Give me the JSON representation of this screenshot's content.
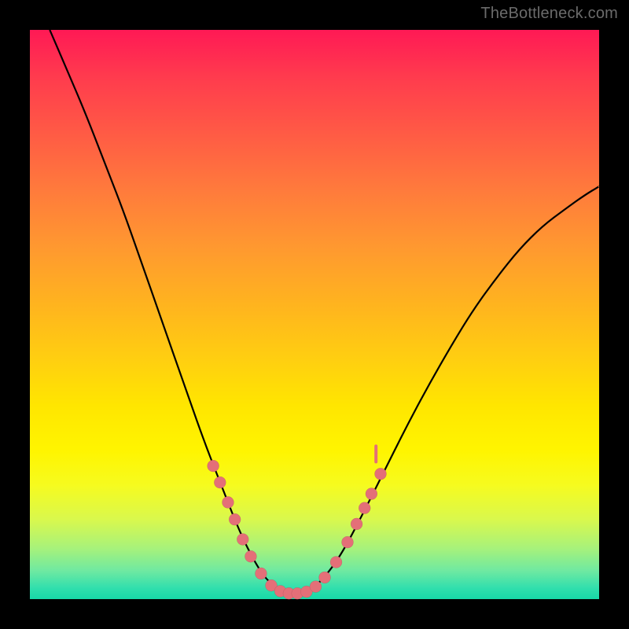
{
  "watermark": "TheBottleneck.com",
  "chart_data": {
    "type": "line",
    "title": "",
    "xlabel": "",
    "ylabel": "",
    "xlim": [
      0,
      1
    ],
    "ylim": [
      0,
      1
    ],
    "series": [
      {
        "name": "bottleneck-curve",
        "points": [
          [
            0.035,
            1.0
          ],
          [
            0.065,
            0.93
          ],
          [
            0.095,
            0.86
          ],
          [
            0.13,
            0.77
          ],
          [
            0.165,
            0.68
          ],
          [
            0.2,
            0.58
          ],
          [
            0.235,
            0.48
          ],
          [
            0.27,
            0.38
          ],
          [
            0.305,
            0.28
          ],
          [
            0.34,
            0.19
          ],
          [
            0.37,
            0.115
          ],
          [
            0.395,
            0.065
          ],
          [
            0.415,
            0.035
          ],
          [
            0.435,
            0.018
          ],
          [
            0.455,
            0.01
          ],
          [
            0.475,
            0.01
          ],
          [
            0.495,
            0.018
          ],
          [
            0.515,
            0.035
          ],
          [
            0.545,
            0.075
          ],
          [
            0.58,
            0.14
          ],
          [
            0.62,
            0.22
          ],
          [
            0.66,
            0.3
          ],
          [
            0.7,
            0.375
          ],
          [
            0.74,
            0.445
          ],
          [
            0.78,
            0.51
          ],
          [
            0.82,
            0.565
          ],
          [
            0.86,
            0.615
          ],
          [
            0.9,
            0.655
          ],
          [
            0.94,
            0.685
          ],
          [
            0.975,
            0.71
          ],
          [
            1.0,
            0.725
          ]
        ]
      }
    ],
    "markers": [
      {
        "xy": [
          0.322,
          0.234
        ],
        "kind": "dot"
      },
      {
        "xy": [
          0.334,
          0.205
        ],
        "kind": "dot"
      },
      {
        "xy": [
          0.348,
          0.17
        ],
        "kind": "dot"
      },
      {
        "xy": [
          0.36,
          0.14
        ],
        "kind": "dot"
      },
      {
        "xy": [
          0.374,
          0.105
        ],
        "kind": "dot"
      },
      {
        "xy": [
          0.388,
          0.075
        ],
        "kind": "dot"
      },
      {
        "xy": [
          0.406,
          0.045
        ],
        "kind": "dot"
      },
      {
        "xy": [
          0.424,
          0.024
        ],
        "kind": "dot"
      },
      {
        "xy": [
          0.44,
          0.014
        ],
        "kind": "dot"
      },
      {
        "xy": [
          0.455,
          0.01
        ],
        "kind": "dot"
      },
      {
        "xy": [
          0.47,
          0.01
        ],
        "kind": "dot"
      },
      {
        "xy": [
          0.486,
          0.013
        ],
        "kind": "dot"
      },
      {
        "xy": [
          0.502,
          0.022
        ],
        "kind": "dot"
      },
      {
        "xy": [
          0.518,
          0.038
        ],
        "kind": "dot"
      },
      {
        "xy": [
          0.538,
          0.065
        ],
        "kind": "dot"
      },
      {
        "xy": [
          0.558,
          0.1
        ],
        "kind": "dot"
      },
      {
        "xy": [
          0.574,
          0.132
        ],
        "kind": "dot"
      },
      {
        "xy": [
          0.588,
          0.16
        ],
        "kind": "dot"
      },
      {
        "xy": [
          0.6,
          0.185
        ],
        "kind": "dot"
      },
      {
        "xy": [
          0.616,
          0.22
        ],
        "kind": "dot"
      },
      {
        "xy": [
          0.608,
          0.255
        ],
        "kind": "tick"
      }
    ]
  },
  "colors": {
    "marker": "#e46f78",
    "curve": "#000000"
  }
}
